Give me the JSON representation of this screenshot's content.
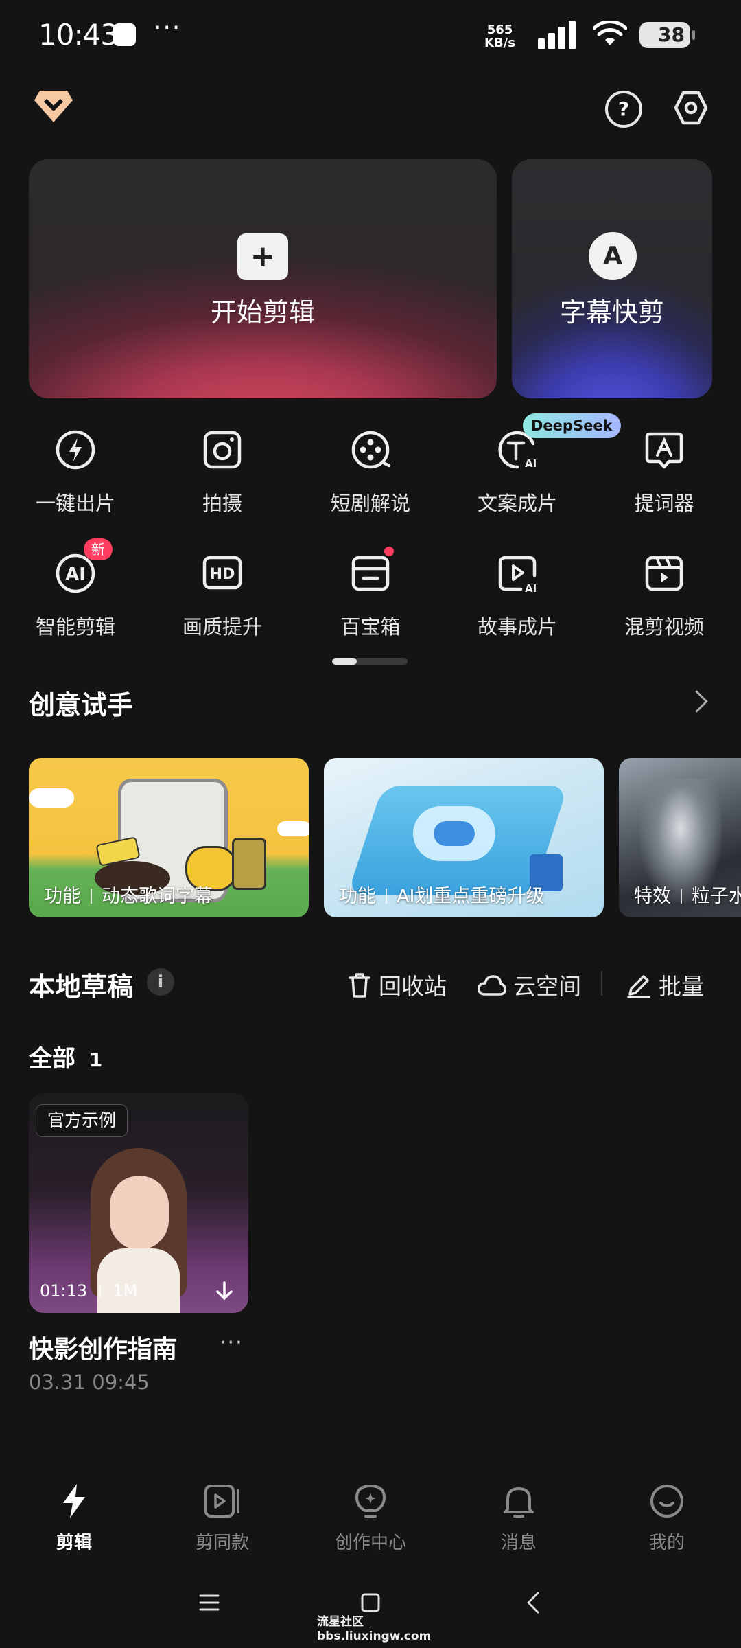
{
  "status_bar": {
    "time": "10:43",
    "dots": "···",
    "net_speed_value": "565",
    "net_speed_unit": "KB/s",
    "battery": "38"
  },
  "header": {
    "logo_icon": "diamond-logo-icon",
    "help_icon": "help-icon",
    "settings_icon": "settings-icon"
  },
  "hero": {
    "start_edit_label": "开始剪辑",
    "subtitle_edit_label": "字幕快剪",
    "subtitle_icon_letter": "A"
  },
  "tools_row1": [
    {
      "label": "一键出片",
      "icon": "lightning-circle-icon"
    },
    {
      "label": "拍摄",
      "icon": "camera-icon"
    },
    {
      "label": "短剧解说",
      "icon": "film-reel-icon"
    },
    {
      "label": "文案成片",
      "icon": "text-ai-icon"
    },
    {
      "label": "提词器",
      "icon": "prompter-icon"
    }
  ],
  "tools_row2": [
    {
      "label": "智能剪辑",
      "icon": "ai-circle-icon"
    },
    {
      "label": "画质提升",
      "icon": "hd-icon"
    },
    {
      "label": "百宝箱",
      "icon": "toolbox-icon"
    },
    {
      "label": "故事成片",
      "icon": "story-ai-icon"
    },
    {
      "label": "混剪视频",
      "icon": "clapper-icon"
    }
  ],
  "badges": {
    "deepseek": "DeepSeek",
    "new": "新",
    "ai_text": "AI",
    "hd_text": "HD"
  },
  "creative": {
    "title": "创意试手",
    "cards": [
      {
        "category": "功能",
        "name": "动态歌词字幕"
      },
      {
        "category": "功能",
        "name": "AI划重点重磅升级"
      },
      {
        "category": "特效",
        "name": "粒子水"
      }
    ]
  },
  "drafts": {
    "title": "本地草稿",
    "info_icon": "i",
    "recycle_label": "回收站",
    "cloud_label": "云空间",
    "batch_label": "批量",
    "filter_label": "全部",
    "filter_count": "1",
    "items": [
      {
        "tag": "官方示例",
        "duration": "01:13",
        "size": "1M",
        "title": "快影创作指南",
        "date": "03.31 09:45",
        "more": "···"
      }
    ]
  },
  "bottom_nav": [
    {
      "label": "剪辑",
      "icon": "bolt-icon",
      "active": true
    },
    {
      "label": "剪同款",
      "icon": "template-play-icon",
      "active": false
    },
    {
      "label": "创作中心",
      "icon": "lightbulb-icon",
      "active": false
    },
    {
      "label": "消息",
      "icon": "bell-icon",
      "active": false
    },
    {
      "label": "我的",
      "icon": "smile-face-icon",
      "active": false
    }
  ],
  "watermark": {
    "line1": "流星社区",
    "line2": "bbs.liuxingw.com"
  }
}
